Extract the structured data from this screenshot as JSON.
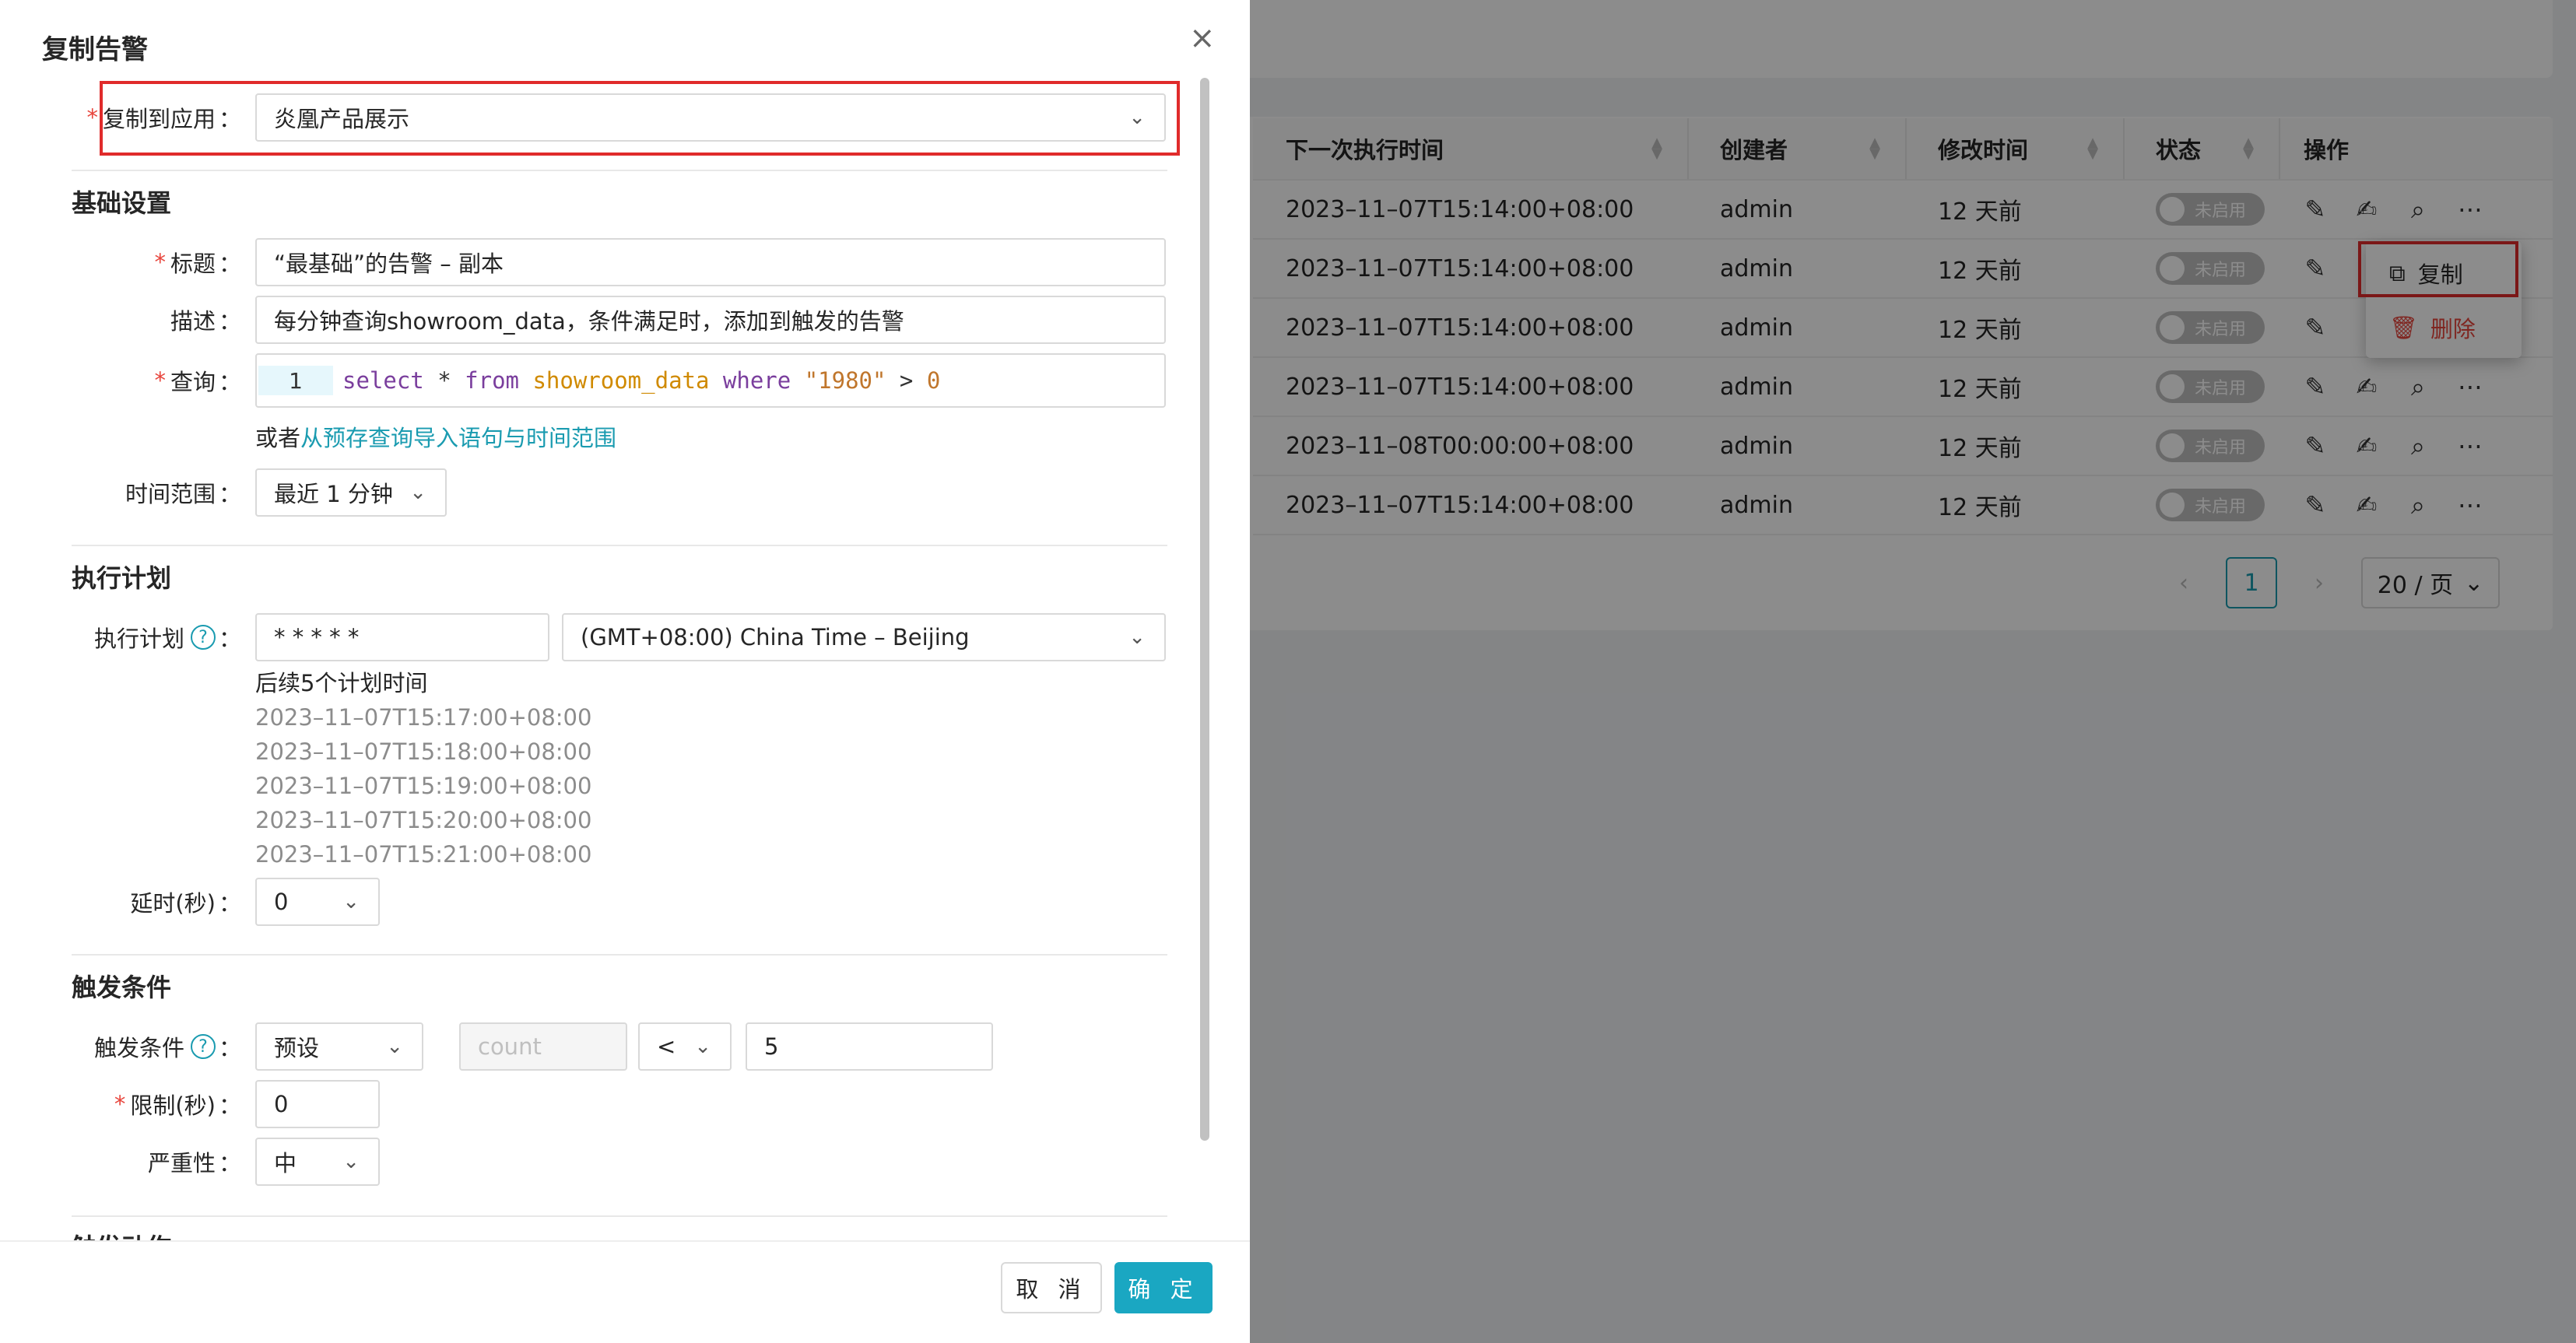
{
  "drawer": {
    "title": "复制告警",
    "close_icon": "×",
    "target_app": {
      "label": "复制到应用",
      "value": "炎凰产品展示"
    },
    "basic": {
      "section_title": "基础设置",
      "title_label": "标题",
      "title_value": "“最基础”的告警 – 副本",
      "desc_label": "描述",
      "desc_value": "每分钟查询showroom_data，条件满足时，添加到触发的告警",
      "query_label": "查询",
      "query_line_no": "1",
      "query_tokens": {
        "t1": "select",
        "t2": " * ",
        "t3": "from",
        "t4": " ",
        "t5": "showroom_data",
        "t6": " ",
        "t7": "where",
        "t8": " ",
        "t9": "\"1980\"",
        "t10": " > ",
        "t11": "0"
      },
      "import_prefix": "或者",
      "import_link": "从预存查询导入语句与时间范围",
      "time_range_label": "时间范围",
      "time_range_value": "最近 1 分钟"
    },
    "schedule": {
      "section_title": "执行计划",
      "label": "执行计划",
      "cron": "* * * * *",
      "timezone": "(GMT+08:00) China Time – Beijing",
      "next_title": "后续5个计划时间",
      "next_times": [
        "2023–11–07T15:17:00+08:00",
        "2023–11–07T15:18:00+08:00",
        "2023–11–07T15:19:00+08:00",
        "2023–11–07T15:20:00+08:00",
        "2023–11–07T15:21:00+08:00"
      ],
      "delay_label": "延时(秒)",
      "delay_value": "0"
    },
    "trigger": {
      "section_title": "触发条件",
      "label": "触发条件",
      "mode": "预设",
      "field_placeholder": "count",
      "operator": "<",
      "threshold": "5",
      "limit_label": "限制(秒)",
      "limit_value": "0",
      "severity_label": "严重性",
      "severity_value": "中"
    },
    "next_section": "触发动作",
    "cancel_label": "取 消",
    "ok_label": "确 定"
  },
  "table": {
    "headers": [
      "下一次执行时间",
      "创建者",
      "修改时间",
      "状态",
      "操作"
    ],
    "rows": [
      {
        "next": "2023–11–07T15:14:00+08:00",
        "creator": "admin",
        "modified": "12 天前",
        "status": "未启用"
      },
      {
        "next": "2023–11–07T15:14:00+08:00",
        "creator": "admin",
        "modified": "12 天前",
        "status": "未启用"
      },
      {
        "next": "2023–11–07T15:14:00+08:00",
        "creator": "admin",
        "modified": "12 天前",
        "status": "未启用"
      },
      {
        "next": "2023–11–07T15:14:00+08:00",
        "creator": "admin",
        "modified": "12 天前",
        "status": "未启用"
      },
      {
        "next": "2023–11–08T00:00:00+08:00",
        "creator": "admin",
        "modified": "12 天前",
        "status": "未启用"
      },
      {
        "next": "2023–11–07T15:14:00+08:00",
        "creator": "admin",
        "modified": "12 天前",
        "status": "未启用"
      }
    ],
    "row_menu": {
      "copy": "复制",
      "delete": "删除"
    }
  },
  "pagination": {
    "current": "1",
    "page_size": "20 / 页"
  },
  "colors": {
    "accent": "#1aa7c2",
    "required": "#e8453c",
    "highlight_box": "#e02b2b"
  }
}
